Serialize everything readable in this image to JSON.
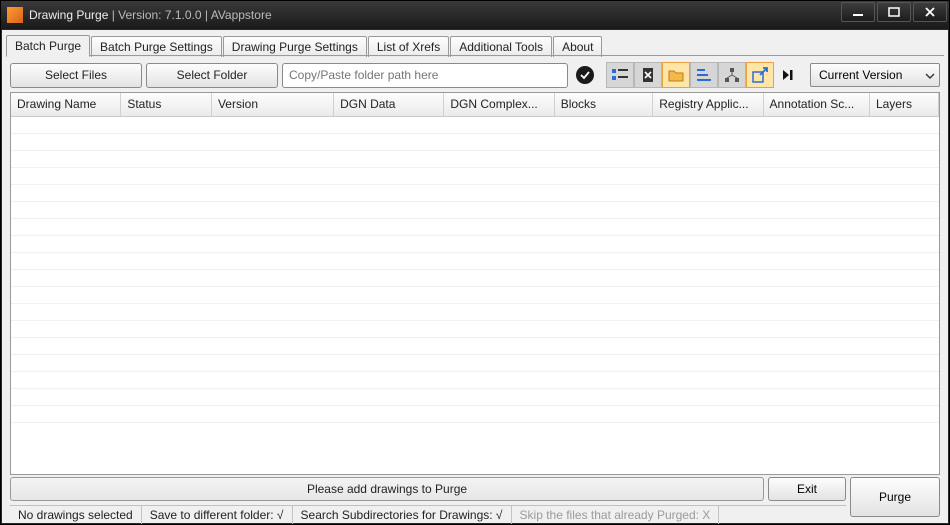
{
  "title": {
    "app": "Drawing Purge",
    "sep1": "  |  Version: ",
    "version": "7.1.0.0",
    "sep2": "   |   ",
    "vendor": "AVappstore"
  },
  "tabs": [
    "Batch Purge",
    "Batch Purge Settings",
    "Drawing Purge Settings",
    "List of Xrefs",
    "Additional Tools",
    "About"
  ],
  "toolbar": {
    "select_files": "Select Files",
    "select_folder": "Select Folder",
    "path_placeholder": "Copy/Paste folder path here",
    "version_dd": "Current Version"
  },
  "columns": [
    "Drawing Name",
    "Status",
    "Version",
    "DGN Data",
    "DGN Complex...",
    "Blocks",
    "Registry Applic...",
    "Annotation Sc...",
    "Layers"
  ],
  "message": "Please add drawings to Purge",
  "buttons": {
    "exit": "Exit",
    "purge": "Purge"
  },
  "status": {
    "selected": "No drawings selected",
    "save_diff": "Save to different folder: √",
    "search_sub": "Search Subdirectories for Drawings: √",
    "skip_purged": "Skip the files that already Purged: X"
  }
}
